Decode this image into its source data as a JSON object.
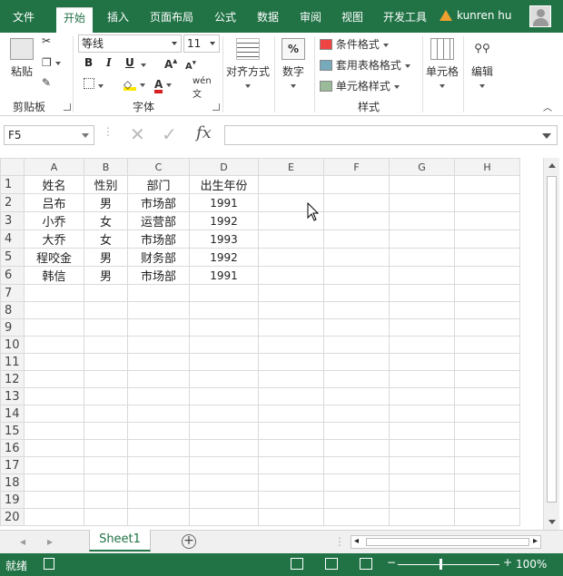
{
  "tabs": [
    {
      "label": "文件"
    },
    {
      "label": "开始"
    },
    {
      "label": "插入"
    },
    {
      "label": "页面布局"
    },
    {
      "label": "公式"
    },
    {
      "label": "数据"
    },
    {
      "label": "审阅"
    },
    {
      "label": "视图"
    },
    {
      "label": "开发工具"
    }
  ],
  "user": {
    "name": "kunren hu"
  },
  "ribbon": {
    "paste_label": "粘贴",
    "clipboard_label": "剪贴板",
    "font_name": "等线",
    "font_size": "11",
    "bold": "B",
    "italic": "I",
    "underline": "U",
    "font_group_label": "字体",
    "align_label": "对齐方式",
    "number_label": "数字",
    "cond_format_label": "条件格式",
    "table_format_label": "套用表格格式",
    "cell_style_label": "单元格样式",
    "styles_group_label": "样式",
    "cells_label": "单元格",
    "edit_label": "编辑"
  },
  "formula_bar": {
    "name_box": "F5",
    "formula": ""
  },
  "sheet": {
    "columns": [
      "A",
      "B",
      "C",
      "D",
      "E",
      "F",
      "G",
      "H"
    ],
    "rows": [
      {
        "n": "1",
        "a": "姓名",
        "b": "性别",
        "c": "部门",
        "d": "出生年份"
      },
      {
        "n": "2",
        "a": "吕布",
        "b": "男",
        "c": "市场部",
        "d": "1991"
      },
      {
        "n": "3",
        "a": "小乔",
        "b": "女",
        "c": "运营部",
        "d": "1992"
      },
      {
        "n": "4",
        "a": "大乔",
        "b": "女",
        "c": "市场部",
        "d": "1993"
      },
      {
        "n": "5",
        "a": "程咬金",
        "b": "男",
        "c": "财务部",
        "d": "1992"
      },
      {
        "n": "6",
        "a": "韩信",
        "b": "男",
        "c": "市场部",
        "d": "1991"
      },
      {
        "n": "7",
        "a": "",
        "b": "",
        "c": "",
        "d": ""
      },
      {
        "n": "8",
        "a": "",
        "b": "",
        "c": "",
        "d": ""
      },
      {
        "n": "9",
        "a": "",
        "b": "",
        "c": "",
        "d": ""
      },
      {
        "n": "10",
        "a": "",
        "b": "",
        "c": "",
        "d": ""
      },
      {
        "n": "11",
        "a": "",
        "b": "",
        "c": "",
        "d": ""
      },
      {
        "n": "12",
        "a": "",
        "b": "",
        "c": "",
        "d": ""
      },
      {
        "n": "13",
        "a": "",
        "b": "",
        "c": "",
        "d": ""
      },
      {
        "n": "14",
        "a": "",
        "b": "",
        "c": "",
        "d": ""
      },
      {
        "n": "15",
        "a": "",
        "b": "",
        "c": "",
        "d": ""
      },
      {
        "n": "16",
        "a": "",
        "b": "",
        "c": "",
        "d": ""
      },
      {
        "n": "17",
        "a": "",
        "b": "",
        "c": "",
        "d": ""
      },
      {
        "n": "18",
        "a": "",
        "b": "",
        "c": "",
        "d": ""
      },
      {
        "n": "19",
        "a": "",
        "b": "",
        "c": "",
        "d": ""
      },
      {
        "n": "20",
        "a": "",
        "b": "",
        "c": "",
        "d": ""
      }
    ]
  },
  "sheet_tab": {
    "label": "Sheet1",
    "add": "+"
  },
  "status": {
    "ready": "就绪",
    "zoom": "100%"
  },
  "colors": {
    "brand": "#217346"
  }
}
